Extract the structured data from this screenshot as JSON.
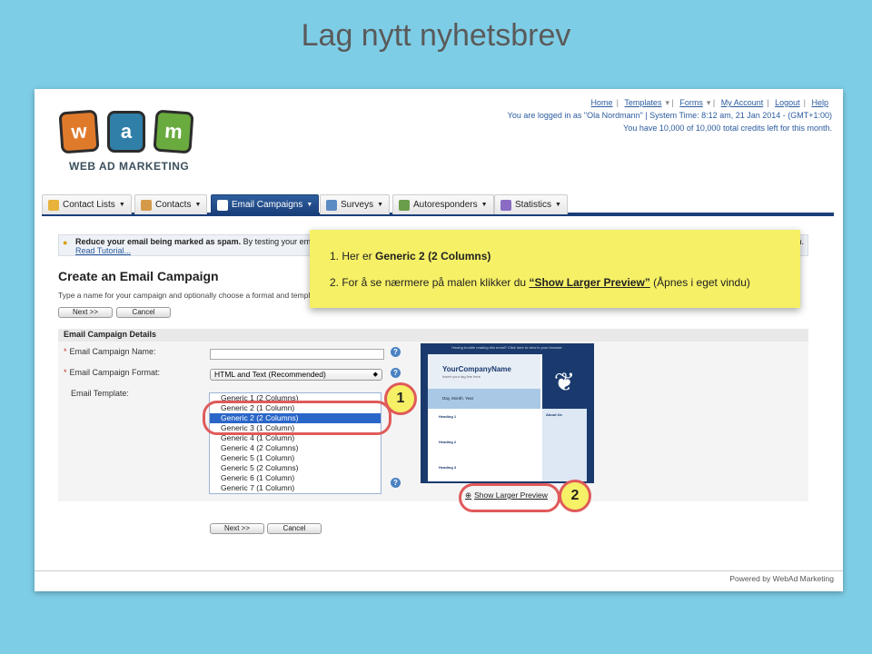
{
  "slide_title": "Lag nytt nyhetsbrev",
  "logo": {
    "text": "WEB AD MARKETING",
    "letters": [
      "w",
      "a",
      "m"
    ],
    "colors": [
      "#e07a2b",
      "#2f7fa8",
      "#6aab3f"
    ]
  },
  "top_links": [
    "Home",
    "Templates",
    "Forms",
    "My Account",
    "Logout",
    "Help"
  ],
  "login_info": "You are logged in as \"Ola Nordmann\" | System Time: 8:12 am, 21 Jan 2014 - (GMT+1:00)",
  "credits_info": "You have 10,000 of 10,000 total credits left for this month.",
  "nav": [
    "Contact Lists",
    "Contacts",
    "Email Campaigns",
    "Surveys",
    "Autoresponders",
    "Statistics"
  ],
  "spam": {
    "bold": "Reduce your email being marked as spam.",
    "text": "By testing your email",
    "link": "Read Tutorial...",
    "tail": "n."
  },
  "page": {
    "title": "Create an Email Campaign",
    "subtitle": "Type a name for your campaign and optionally choose a format and templa",
    "next_label": "Next >>",
    "cancel_label": "Cancel"
  },
  "details": {
    "header": "Email Campaign Details",
    "name_label": "Email Campaign Name:",
    "format_label": "Email Campaign Format:",
    "format_value": "HTML and Text (Recommended)",
    "template_label": "Email Template:",
    "templates": [
      "Generic 1 (2 Columns)",
      "Generic 2 (1 Column)",
      "Generic 2 (2 Columns)",
      "Generic 3 (1 Column)",
      "Generic 4 (1 Column)",
      "Generic 4 (2 Columns)",
      "Generic 5 (1 Column)",
      "Generic 5 (2 Columns)",
      "Generic 6 (1 Column)",
      "Generic 7 (1 Column)"
    ],
    "selected_index": 2
  },
  "preview": {
    "top_text": "Having trouble reading this email? Click here to view in your browser.",
    "brand": "YourCompanyName",
    "tagline": "Insert your tag line here",
    "date": "Day, Month, Year",
    "headings": [
      "Heading 1",
      "Heading 2",
      "Heading 3"
    ],
    "about": "About Us",
    "show_larger": "Show Larger Preview"
  },
  "powered": "Powered by WebAd Marketing",
  "callout": {
    "line1_prefix": "1. Her er",
    "line1_bold": "Generic 2 (2 Columns)",
    "line2_prefix": "2. For å se nærmere på malen klikker du",
    "line2_link": "“Show Larger Preview”",
    "line2_suffix": "(Åpnes i eget vindu)"
  },
  "badges": [
    "1",
    "2"
  ]
}
